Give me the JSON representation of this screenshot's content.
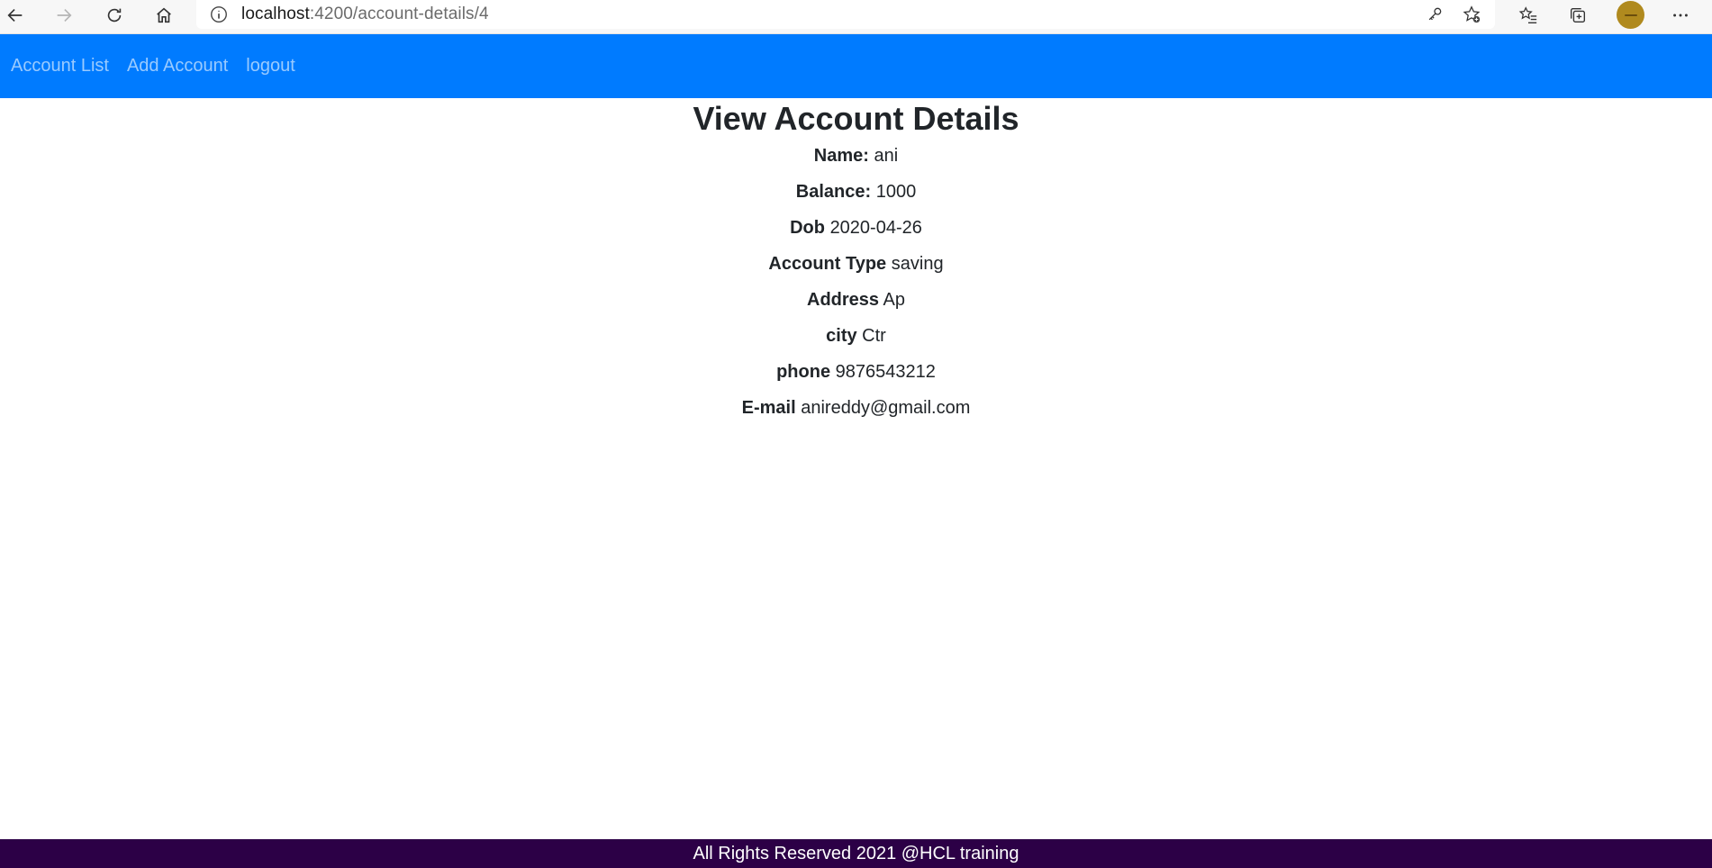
{
  "browser": {
    "url_host": "localhost",
    "url_path": ":4200/account-details/4"
  },
  "navbar": {
    "links": [
      {
        "label": "Account List"
      },
      {
        "label": "Add Account"
      },
      {
        "label": "logout"
      }
    ],
    "background": "#007bff"
  },
  "main": {
    "title": "View Account Details",
    "details": [
      {
        "label": "Name:",
        "value": "ani"
      },
      {
        "label": "Balance:",
        "value": "1000"
      },
      {
        "label": "Dob",
        "value": "2020-04-26"
      },
      {
        "label": "Account Type",
        "value": "saving"
      },
      {
        "label": "Address",
        "value": "Ap"
      },
      {
        "label": "city",
        "value": "Ctr"
      },
      {
        "label": "phone",
        "value": "9876543212"
      },
      {
        "label": "E-mail",
        "value": "anireddy@gmail.com"
      }
    ]
  },
  "footer": {
    "text": "All Rights Reserved 2021 @HCL training",
    "background": "#2c0046"
  }
}
